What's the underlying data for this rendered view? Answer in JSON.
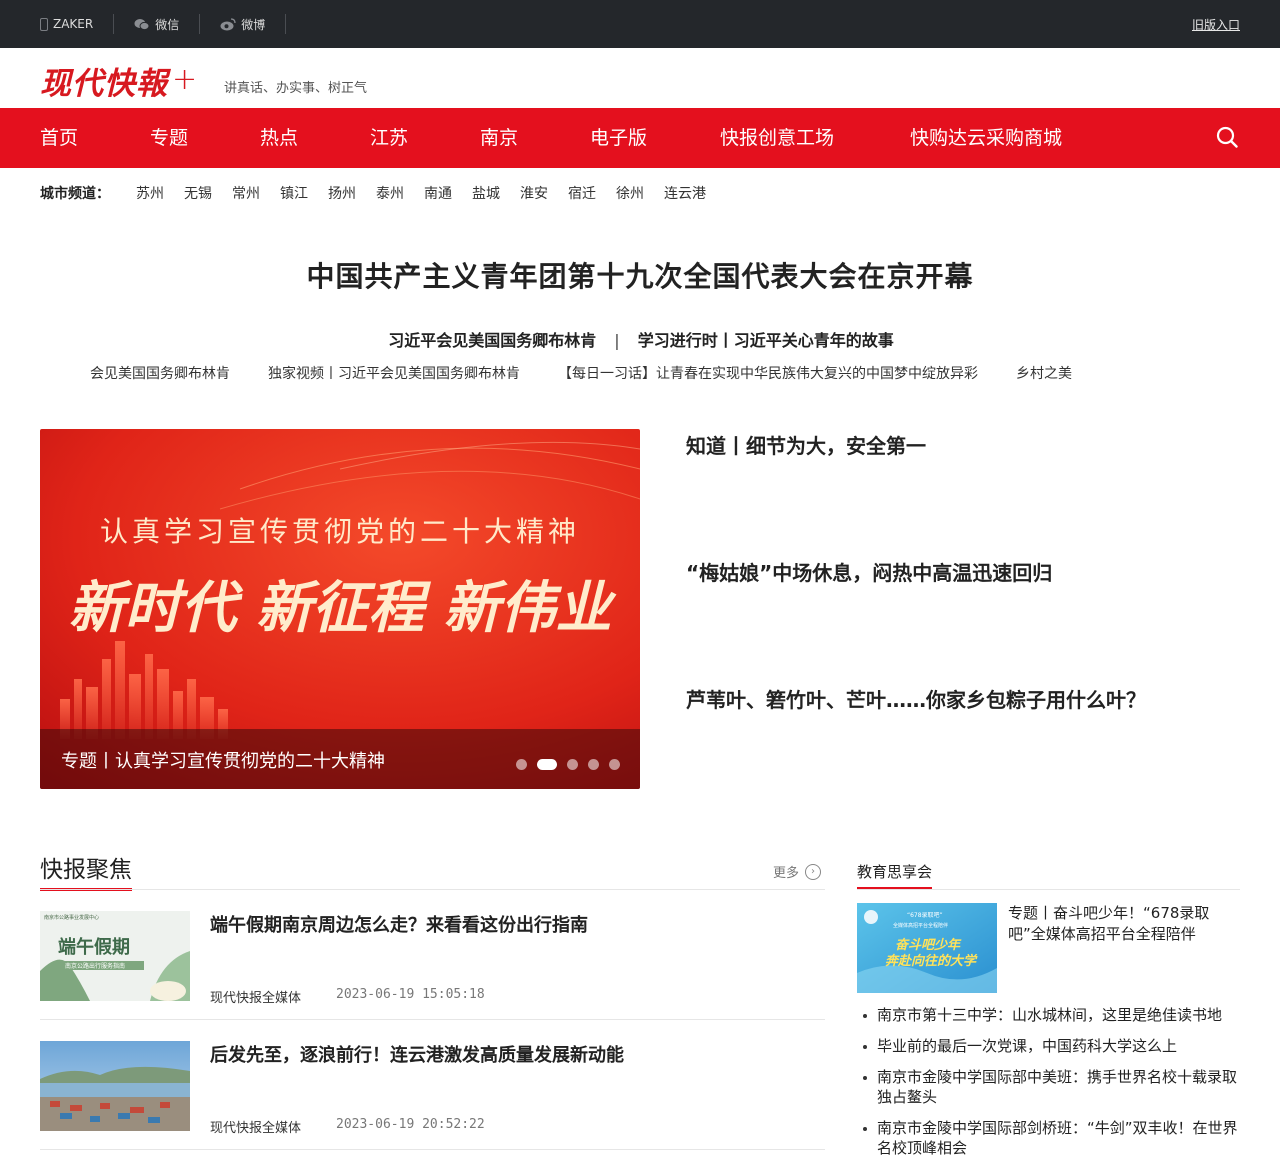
{
  "topbar": {
    "items": [
      {
        "label": "ZAKER",
        "icon": "phone-icon"
      },
      {
        "label": "微信",
        "icon": "wechat-icon"
      },
      {
        "label": "微博",
        "icon": "weibo-icon"
      }
    ],
    "old_version": "旧版入口"
  },
  "header": {
    "logo": "现代快報",
    "logo_plus": "+",
    "slogan": "讲真话、办实事、树正气"
  },
  "nav": {
    "items": [
      "首页",
      "专题",
      "热点",
      "江苏",
      "南京",
      "电子版",
      "快报创意工场",
      "快购达云采购商城"
    ]
  },
  "city": {
    "label": "城市频道：",
    "items": [
      "苏州",
      "无锡",
      "常州",
      "镇江",
      "扬州",
      "泰州",
      "南通",
      "盐城",
      "淮安",
      "宿迁",
      "徐州",
      "连云港"
    ]
  },
  "headline": "中国共产主义青年团第十九次全国代表大会在京开幕",
  "sub_links": [
    "习近平会见美国国务卿布林肯",
    "|",
    "学习进行时丨习近平关心青年的故事"
  ],
  "ticker": [
    "会见美国国务卿布林肯",
    "独家视频丨习近平会见美国国务卿布林肯",
    "【每日一习话】让青春在实现中华民族伟大复兴的中国梦中绽放异彩",
    "乡村之美"
  ],
  "slider": {
    "banner_line1": "认真学习宣传贯彻党的二十大精神",
    "banner_line2": "新时代 新征程 新伟业",
    "caption": "专题丨认真学习宣传贯彻党的二十大精神",
    "active_dot": 2,
    "dot_count": 5
  },
  "side_news": [
    "知道丨细节为大，安全第一",
    "“梅姑娘”中场休息，闷热中高温迅速回归",
    "芦苇叶、箬竹叶、芒叶……你家乡包粽子用什么叶？"
  ],
  "kuaibao": {
    "title": "快报聚焦",
    "more": "更多",
    "articles": [
      {
        "title": "端午假期南京周边怎么走？来看看这份出行指南",
        "source": "现代快报全媒体",
        "time": "2023-06-19 15:05:18",
        "thumb_text": "端午假期",
        "thumb_small": "南京市公路事业发展中心",
        "thumb_sub": "南京公路出行服务指南"
      },
      {
        "title": "后发先至，逐浪前行！连云港激发高质量发展新动能",
        "source": "现代快报全媒体",
        "time": "2023-06-19 20:52:22"
      }
    ]
  },
  "education": {
    "title": "教育思享会",
    "feature": {
      "text": "专题丨奋斗吧少年！“678录取吧”全媒体高招平台全程陪伴",
      "thumb_text": "奋斗吧少年",
      "thumb_text2": "奔赴向往的大学",
      "thumb_small": "“678录取吧”",
      "thumb_small2": "全媒体高招平台全程陪伴"
    },
    "list": [
      "南京市第十三中学：山水城林间，这里是绝佳读书地",
      "毕业前的最后一次党课，中国药科大学这么上",
      "南京市金陵中学国际部中美班：携手世界名校十载录取独占鳌头",
      "南京市金陵中学国际部剑桥班：“牛剑”双丰收！在世界名校顶峰相会"
    ]
  },
  "colors": {
    "brand_red": "#e4101e",
    "topbar": "#24272b"
  }
}
